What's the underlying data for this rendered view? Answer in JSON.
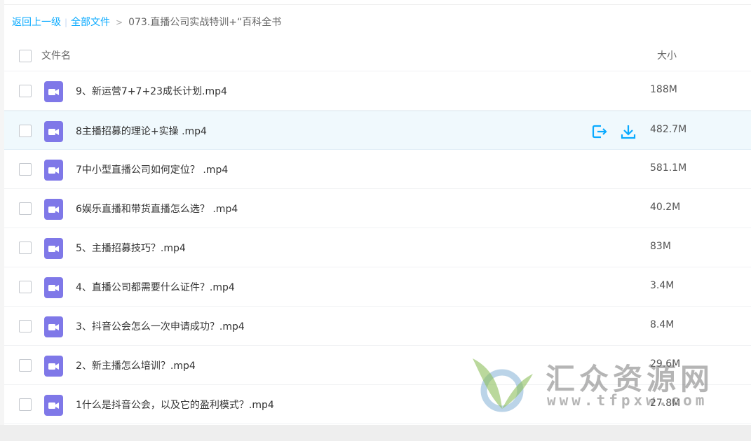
{
  "breadcrumb": {
    "back": "返回上一级",
    "separator": "|",
    "all_files": "全部文件",
    "arrow": ">",
    "current": "073.直播公司实战特训+“百科全书"
  },
  "header": {
    "name": "文件名",
    "size": "大小"
  },
  "files": [
    {
      "name": "9、新运营7+7+23成长计划.mp4",
      "size": "188M",
      "icon": "video-file-icon"
    },
    {
      "name": "8主播招募的理论+实操 .mp4",
      "size": "482.7M",
      "icon": "video-file-icon"
    },
    {
      "name": "7中小型直播公司如何定位？ .mp4",
      "size": "581.1M",
      "icon": "video-file-icon"
    },
    {
      "name": "6娱乐直播和带货直播怎么选？ .mp4",
      "size": "40.2M",
      "icon": "video-file-icon"
    },
    {
      "name": "5、主播招募技巧？.mp4",
      "size": "83M",
      "icon": "video-file-icon"
    },
    {
      "name": "4、直播公司都需要什么证件？.mp4",
      "size": "3.4M",
      "icon": "video-file-icon"
    },
    {
      "name": "3、抖音公会怎么一次申请成功？.mp4",
      "size": "8.4M",
      "icon": "video-file-icon"
    },
    {
      "name": "2、新主播怎么培训？.mp4",
      "size": "29.6M",
      "icon": "video-file-icon"
    },
    {
      "name": "1什么是抖音公会，以及它的盈利模式？.mp4",
      "size": "27.8M",
      "icon": "video-file-icon"
    }
  ],
  "row_actions": {
    "share_icon": "share-export-icon",
    "download_icon": "download-icon"
  },
  "watermark": {
    "brand": "汇众资源网",
    "url": "www.tfpxw.com"
  },
  "colors": {
    "link": "#09aaff",
    "file_icon": "#7f78e8",
    "action_icon": "#09aaff",
    "hover_row": "#f0f9fd"
  }
}
